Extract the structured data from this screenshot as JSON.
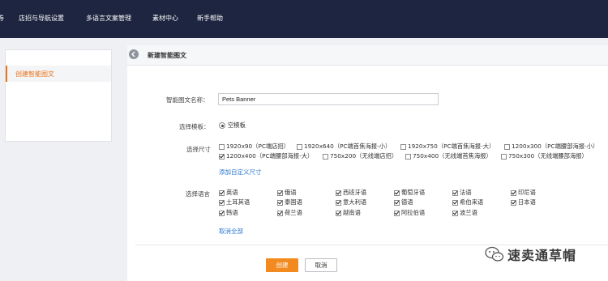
{
  "topnav": {
    "items": [
      "券",
      "店招与导航设置",
      "多语言文案管理",
      "素材中心",
      "新手帮助"
    ]
  },
  "sidebar": {
    "items": [
      {
        "label": "创建智能图文",
        "active": true
      }
    ]
  },
  "main": {
    "title": "新建智能图文",
    "form": {
      "name_label": "智能图文名称：",
      "name_value": "Pets Banner",
      "template_label": "选择模板：",
      "template_option": "空模板",
      "size_label": "选择尺寸",
      "sizes": [
        {
          "label": "1920x90（PC端店招）",
          "checked": false
        },
        {
          "label": "1920x640（PC端首焦海报-小）",
          "checked": false
        },
        {
          "label": "1920x750（PC端首焦海报-大）",
          "checked": false
        },
        {
          "label": "1200x300（PC端腰部海报-小）",
          "checked": false
        },
        {
          "label": "1200x400（PC端腰部海报-大）",
          "checked": true
        },
        {
          "label": "750x200（无线端店招）",
          "checked": false
        },
        {
          "label": "750x400（无线端首焦海报）",
          "checked": false
        },
        {
          "label": "750x300（无线端腰部海报）",
          "checked": false
        }
      ],
      "add_size_link": "添加自定义尺寸",
      "language_label": "选择语言",
      "languages": [
        {
          "label": "英语",
          "checked": true
        },
        {
          "label": "俄语",
          "checked": true
        },
        {
          "label": "西班牙语",
          "checked": true
        },
        {
          "label": "葡萄牙语",
          "checked": true
        },
        {
          "label": "法语",
          "checked": true
        },
        {
          "label": "印尼语",
          "checked": true
        },
        {
          "label": "土耳其语",
          "checked": true
        },
        {
          "label": "泰国语",
          "checked": true
        },
        {
          "label": "意大利语",
          "checked": true
        },
        {
          "label": "德语",
          "checked": true
        },
        {
          "label": "希伯来语",
          "checked": true
        },
        {
          "label": "日本语",
          "checked": true
        },
        {
          "label": "韩语",
          "checked": true
        },
        {
          "label": "荷兰语",
          "checked": true
        },
        {
          "label": "越南语",
          "checked": true
        },
        {
          "label": "阿拉伯语",
          "checked": true
        },
        {
          "label": "波兰语",
          "checked": true
        }
      ],
      "cancel_all_link": "取消全部"
    },
    "buttons": {
      "create": "创建",
      "cancel": "取消"
    }
  },
  "watermark": {
    "text": "速卖通草帽"
  },
  "colors": {
    "nav_bg": "#1e2540",
    "accent": "#f28a1f",
    "link": "#2b78d0"
  }
}
